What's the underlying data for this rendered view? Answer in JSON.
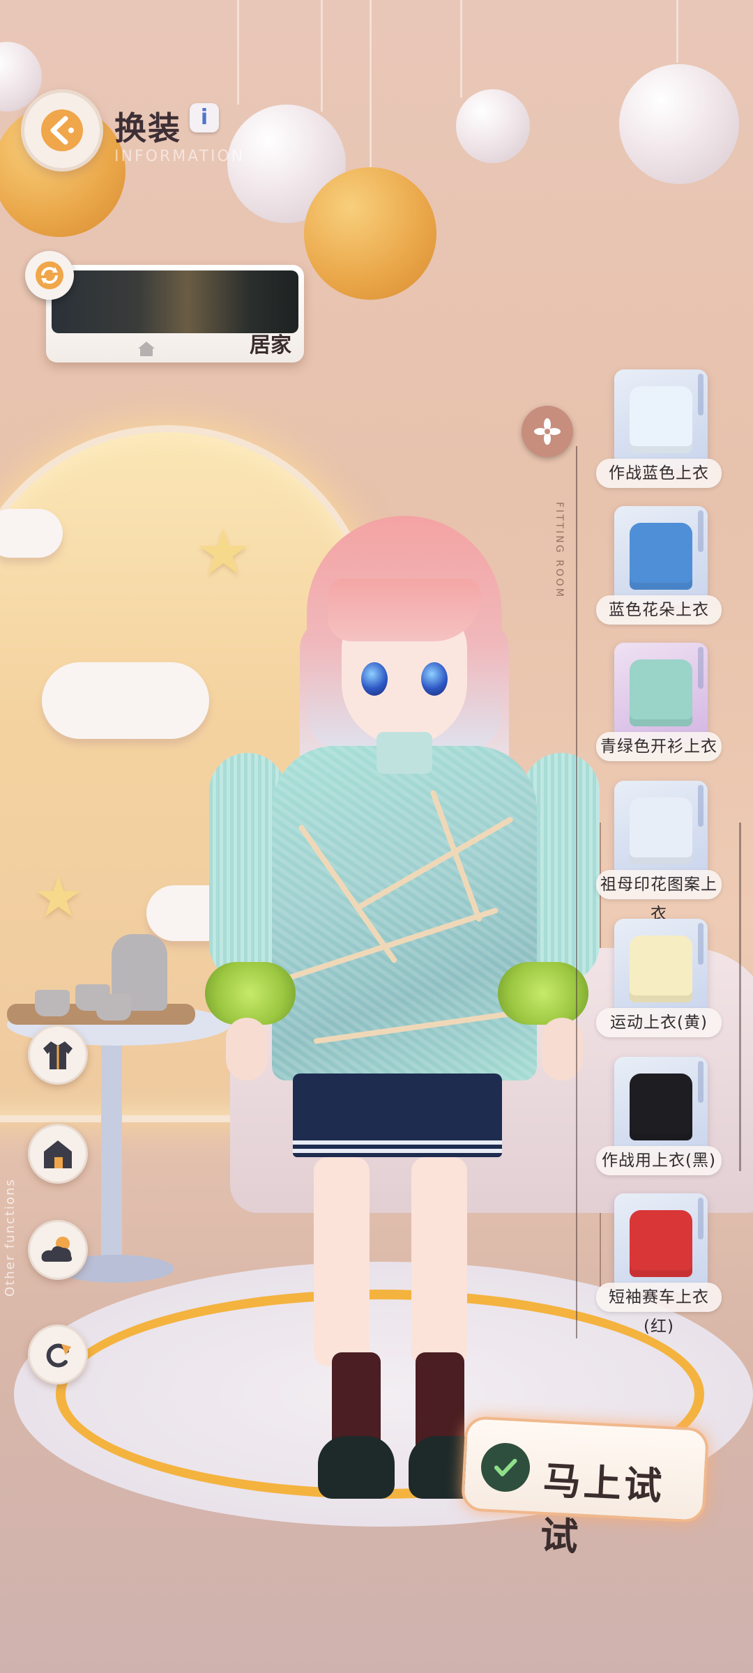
{
  "header": {
    "title": "换装",
    "info_icon": "i",
    "subtitle": "INFORMATION"
  },
  "scene_selector": {
    "label": "居家",
    "home_icon": "home-icon",
    "refresh_icon": "refresh-icon"
  },
  "fitting_room": {
    "label": "FITTING ROOM",
    "badge_icon": "flower-icon"
  },
  "wardrobe": {
    "items": [
      {
        "label": "作战蓝色上衣",
        "garment_color": "#eaf3fb"
      },
      {
        "label": "蓝色花朵上衣",
        "garment_color": "#4f8fd8"
      },
      {
        "label": "青绿色开衫上衣",
        "garment_color": "#9ad3c8"
      },
      {
        "label": "祖母印花图案上衣",
        "garment_color": "#e8eef8"
      },
      {
        "label": "运动上衣(黄)",
        "garment_color": "#f7edc2"
      },
      {
        "label": "作战用上衣(黑)",
        "garment_color": "#1d1d22"
      },
      {
        "label": "短袖赛车上衣(红)",
        "garment_color": "#d93638"
      }
    ]
  },
  "side_buttons": [
    {
      "name": "outfit-button",
      "icon": "jacket-icon"
    },
    {
      "name": "room-button",
      "icon": "house-icon"
    },
    {
      "name": "weather-button",
      "icon": "cloud-sun-icon"
    },
    {
      "name": "reset-button",
      "icon": "rotate-icon"
    }
  ],
  "side_label": "Other functions",
  "try_button": {
    "label": "马上试试",
    "icon": "check-icon"
  },
  "colors": {
    "accent": "#f0b88c",
    "panel_bg": "#f7efea"
  }
}
